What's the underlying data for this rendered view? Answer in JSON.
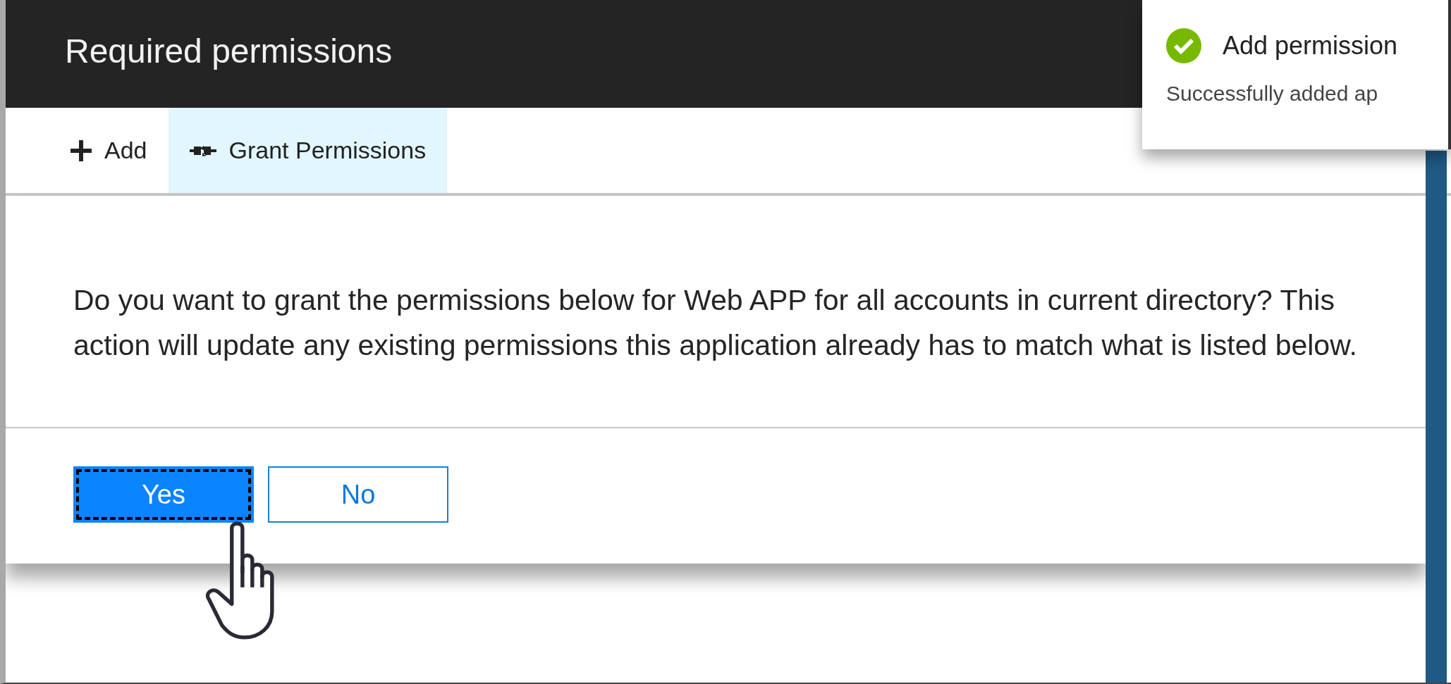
{
  "header": {
    "title": "Required permissions"
  },
  "toolbar": [
    {
      "kind": "add",
      "label": "Add",
      "selected": false
    },
    {
      "kind": "grant",
      "label": "Grant Permissions",
      "selected": true
    }
  ],
  "dialog": {
    "message": "Do you want to grant the permissions below for Web APP for all accounts in current directory? This action will update any existing permissions this application already has to match what is listed below.",
    "buttons": [
      {
        "kind": "primary",
        "label": "Yes",
        "focused": true
      },
      {
        "kind": "secondary",
        "label": "No",
        "focused": false
      }
    ]
  },
  "notification": {
    "success": true,
    "title": "Add permission",
    "message": "Successfully added ap"
  }
}
